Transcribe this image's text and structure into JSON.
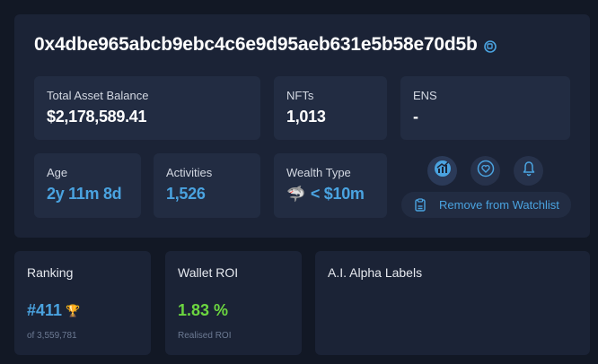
{
  "wallet": {
    "address": "0x4dbe965abcb9ebc4c6e9d95aeb631e5b58e70d5b"
  },
  "stats": {
    "total_asset_balance_label": "Total Asset Balance",
    "total_asset_balance": "$2,178,589.41",
    "nfts_label": "NFTs",
    "nfts": "1,013",
    "ens_label": "ENS",
    "ens": "-",
    "age_label": "Age",
    "age": "2y 11m 8d",
    "activities_label": "Activities",
    "activities": "1,526",
    "wealth_type_label": "Wealth Type",
    "wealth_type_emoji": "🦈",
    "wealth_type": "< $10m"
  },
  "actions": {
    "remove_watchlist_label": "Remove from Watchlist",
    "icons": [
      "chart-icon",
      "heart-icon",
      "bell-icon",
      "clipboard-icon",
      "copy-icon"
    ]
  },
  "ranking": {
    "title": "Ranking",
    "rank": "#411",
    "trophy": "🏆",
    "of_total": "of 3,559,781"
  },
  "roi": {
    "title": "Wallet ROI",
    "value": "1.83 %",
    "sub_label": "Realised ROI"
  },
  "alpha_labels": {
    "title": "A.I. Alpha Labels"
  },
  "colors": {
    "background": "#121825",
    "panel": "#1b2336",
    "card": "#222c42",
    "accent_blue": "#4aa3e0",
    "accent_green": "#6cd640"
  }
}
